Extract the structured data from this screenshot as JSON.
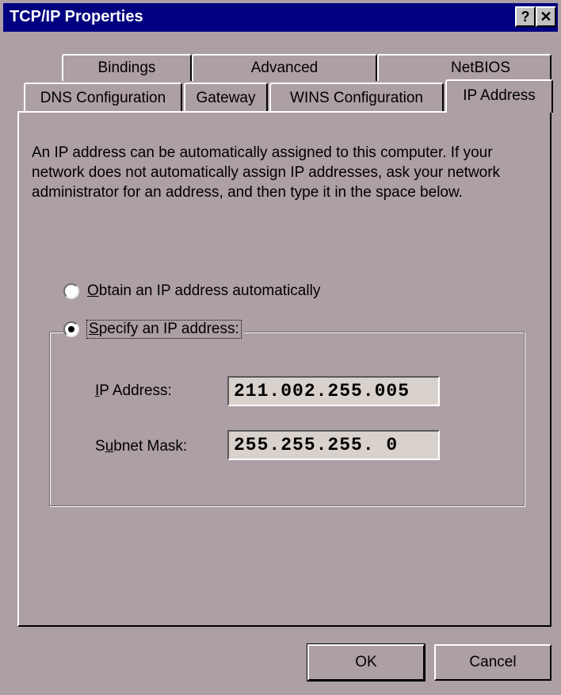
{
  "window": {
    "title": "TCP/IP Properties",
    "help_label": "?",
    "close_label": "✕"
  },
  "tabs_row1": [
    "Bindings",
    "Advanced",
    "NetBIOS"
  ],
  "tabs_row2": [
    "DNS Configuration",
    "Gateway",
    "WINS Configuration",
    "IP Address"
  ],
  "active_tab": "IP Address",
  "description": "An IP address can be automatically assigned to this computer. If your network does not automatically assign IP addresses, ask your network administrator for an address, and then type it in the space below.",
  "options": {
    "obtain_automatic": {
      "underline": "O",
      "rest": "btain an IP address automatically",
      "checked": false
    },
    "specify": {
      "underline": "S",
      "rest": "pecify an IP address:",
      "checked": true
    }
  },
  "fields": {
    "ip_label_u": "I",
    "ip_label_rest": "P Address:",
    "ip_value": "211.002.255.005",
    "mask_label_pre": "S",
    "mask_label_u": "u",
    "mask_label_rest": "bnet Mask:",
    "mask_value": "255.255.255. 0"
  },
  "buttons": {
    "ok": "OK",
    "cancel": "Cancel"
  },
  "colors": {
    "titlebar": "#000080",
    "face": "#ad9fa6",
    "field": "#d9d2cc"
  }
}
